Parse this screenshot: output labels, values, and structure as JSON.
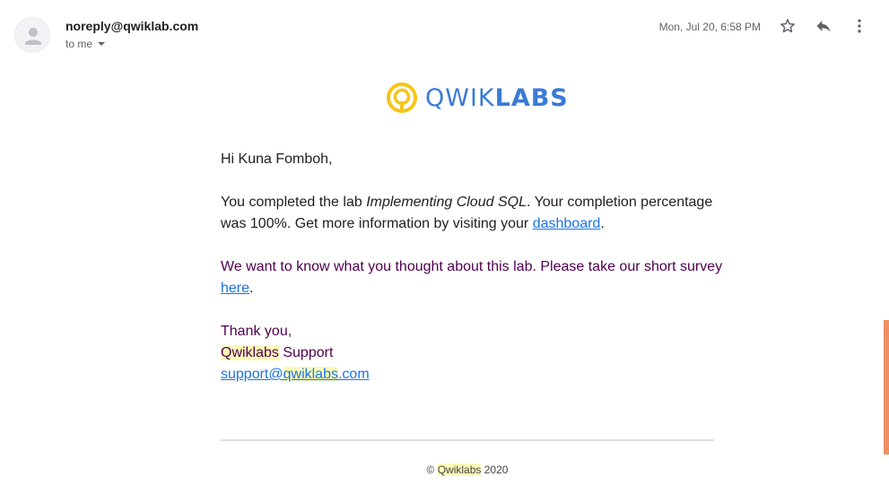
{
  "header": {
    "sender": "noreply@qwiklab.com",
    "recipient": "to me",
    "date": "Mon, Jul 20, 6:58 PM"
  },
  "icons": {
    "avatar": "person-icon",
    "star": "star-icon",
    "reply": "reply-icon",
    "more": "more-vert-icon",
    "logo": "qwiklabs-logo-icon"
  },
  "logo": {
    "part1": "QWIK",
    "part2": "LABS"
  },
  "body": {
    "greeting": "Hi Kuna Fomboh,",
    "completion_prefix": "You completed the lab ",
    "lab_name": "Implementing Cloud SQL",
    "completion_middle": ". Your completion percentage was 100%. Get more information by visiting your ",
    "dashboard_link": "dashboard",
    "completion_suffix": ".",
    "survey_prefix": "We want to know what you thought about this lab. Please take our short survey ",
    "survey_link": "here",
    "survey_suffix": ".",
    "thanks": "Thank you,",
    "sign_brand": "Qwiklabs",
    "sign_suffix": " Support",
    "email_prefix": "support@",
    "email_brand": "qwiklabs",
    "email_suffix": ".com"
  },
  "footer": {
    "copyright_symbol": "©",
    "brand": "Qwiklabs",
    "year": "2020"
  },
  "colors": {
    "link": "#1a73e8",
    "quoted_text": "#500050",
    "logo_blue": "#3a7bd5",
    "logo_yellow": "#f5c518",
    "highlight": "#fcfab8",
    "scroll_marker": "#ef8f63"
  }
}
